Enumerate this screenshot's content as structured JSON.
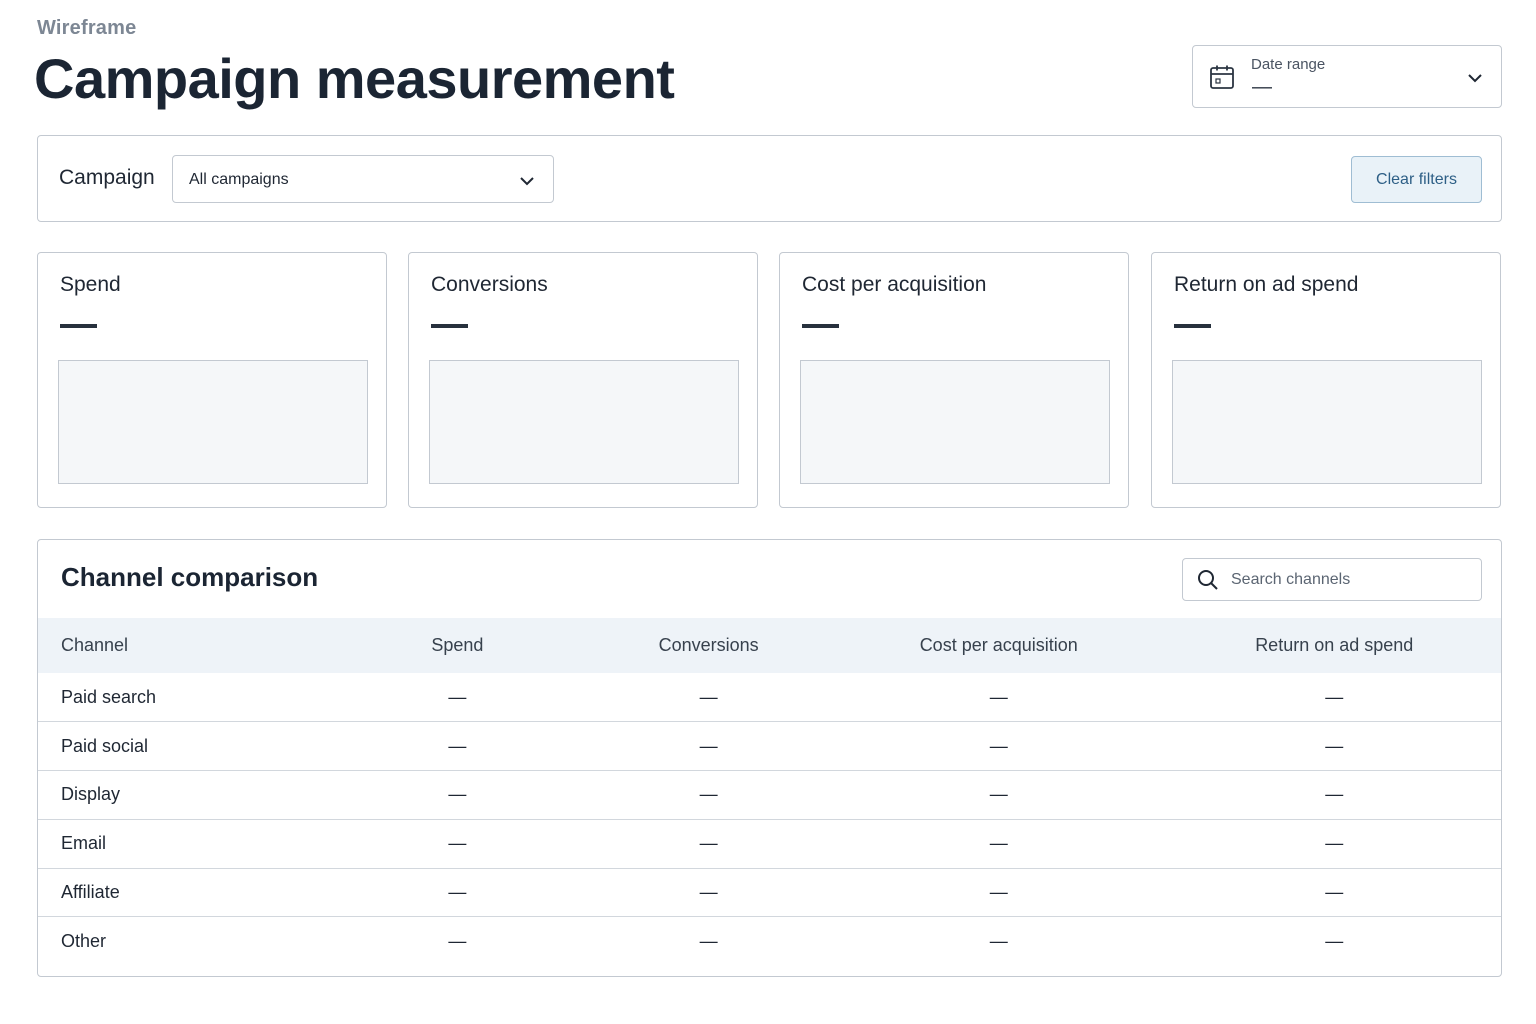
{
  "header": {
    "eyebrow": "Wireframe",
    "title": "Campaign measurement"
  },
  "date_range": {
    "label": "Date range",
    "value": "—",
    "icon": "calendar-icon"
  },
  "filters": {
    "campaign_label": "Campaign",
    "campaign_value": "All campaigns",
    "clear_label": "Clear filters"
  },
  "kpis": [
    {
      "title": "Spend",
      "value": "—"
    },
    {
      "title": "Conversions",
      "value": "—"
    },
    {
      "title": "Cost per acquisition",
      "value": "—"
    },
    {
      "title": "Return on ad spend",
      "value": "—"
    }
  ],
  "channel_table": {
    "title": "Channel comparison",
    "search_placeholder": "Search channels",
    "columns": [
      "Channel",
      "Spend",
      "Conversions",
      "Cost per acquisition",
      "Return on ad spend"
    ],
    "rows": [
      [
        "Paid search",
        "—",
        "—",
        "—",
        "—"
      ],
      [
        "Paid social",
        "—",
        "—",
        "—",
        "—"
      ],
      [
        "Display",
        "—",
        "—",
        "—",
        "—"
      ],
      [
        "Email",
        "—",
        "—",
        "—",
        "—"
      ],
      [
        "Affiliate",
        "—",
        "—",
        "—",
        "—"
      ],
      [
        "Other",
        "—",
        "—",
        "—",
        "—"
      ]
    ]
  },
  "colors": {
    "border": "#c3c9d1",
    "accent": "#2d5f86",
    "accent_bg": "#e9f2f8",
    "table_header_bg": "#eef3f8"
  }
}
